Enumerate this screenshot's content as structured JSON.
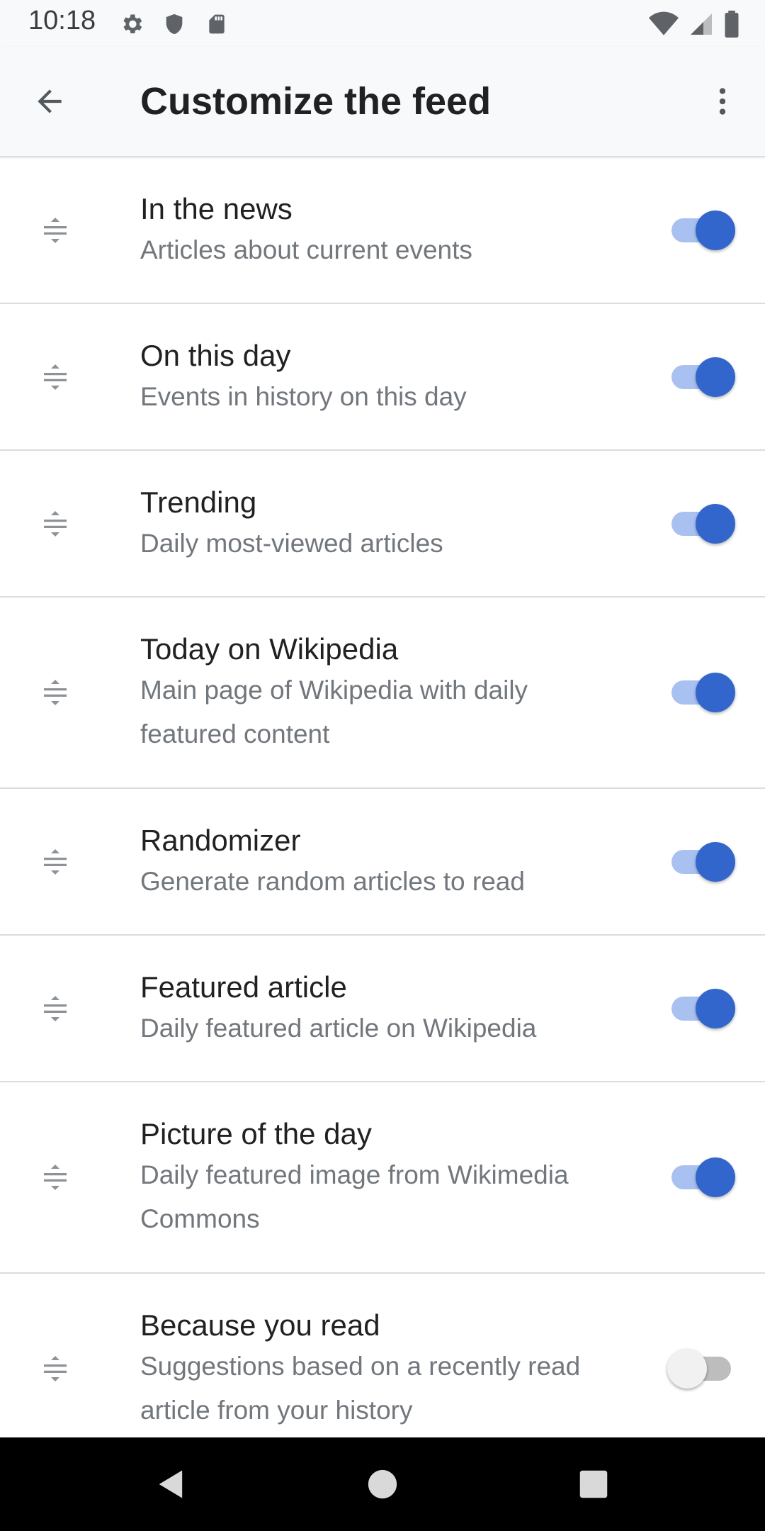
{
  "status_bar": {
    "time": "10:18",
    "left_icons": [
      "gear-icon",
      "shield-icon",
      "sd-card-icon"
    ],
    "right_icons": [
      "wifi-icon",
      "cell-signal-icon",
      "battery-icon"
    ]
  },
  "app_bar": {
    "title": "Customize the feed",
    "back_icon": "arrow-back-icon",
    "menu_icon": "more-vert-icon"
  },
  "colors": {
    "accent": "#3366cc",
    "toggle_track_on": "#a9c1f0",
    "title_text": "#202122",
    "secondary_text": "#72777d",
    "divider": "#dadce0"
  },
  "feed_items": [
    {
      "title": "In the news",
      "description": "Articles about current events",
      "enabled": true
    },
    {
      "title": "On this day",
      "description": "Events in history on this day",
      "enabled": true
    },
    {
      "title": "Trending",
      "description": "Daily most-viewed articles",
      "enabled": true
    },
    {
      "title": "Today on Wikipedia",
      "description": "Main page of Wikipedia with daily featured content",
      "enabled": true
    },
    {
      "title": "Randomizer",
      "description": "Generate random articles to read",
      "enabled": true
    },
    {
      "title": "Featured article",
      "description": "Daily featured article on Wikipedia",
      "enabled": true
    },
    {
      "title": "Picture of the day",
      "description": "Daily featured image from Wikimedia Commons",
      "enabled": true
    },
    {
      "title": "Because you read",
      "description": "Suggestions based on a recently read article from your history",
      "enabled": false
    }
  ],
  "nav_bar": {
    "icons": [
      "nav-back-icon",
      "nav-home-icon",
      "nav-recents-icon"
    ]
  }
}
